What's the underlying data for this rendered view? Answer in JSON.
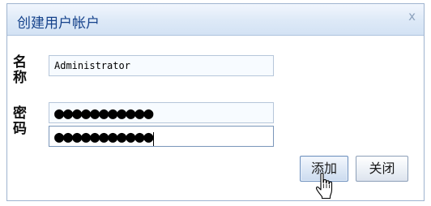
{
  "dialog": {
    "title": "创建用户帐户",
    "close_icon": "close-icon",
    "close_glyph": "x"
  },
  "form": {
    "name_label": "名称",
    "name_value": "Administrator",
    "password_label": "密码",
    "password_value": "●●●●●●●●●●●",
    "confirm_value": "●●●●●●●●●●●"
  },
  "buttons": {
    "add_label": "添加",
    "close_label": "关闭"
  },
  "cursor": {
    "icon": "hand-pointer-icon"
  }
}
